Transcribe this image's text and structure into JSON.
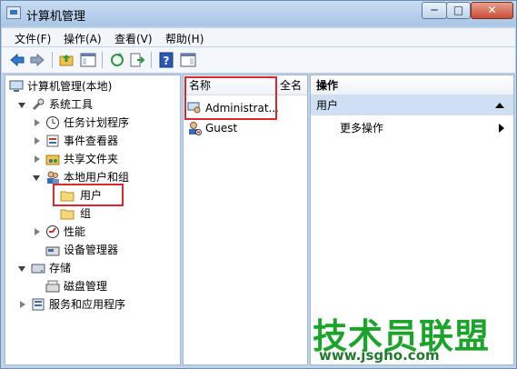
{
  "window": {
    "title": "计算机管理",
    "minimize": "─",
    "maximize": "□",
    "close": "✕"
  },
  "menu": [
    "文件(F)",
    "操作(A)",
    "查看(V)",
    "帮助(H)"
  ],
  "toolbar": {
    "icons": [
      "back-arrow-icon",
      "forward-arrow-icon",
      "folder-up-icon",
      "console-tree-icon",
      "refresh-icon",
      "export-list-icon",
      "help-icon",
      "show-hide-pane-icon"
    ]
  },
  "tree": [
    {
      "label": "计算机管理(本地)",
      "icon": "computer-management-icon",
      "level": 0,
      "expander": "none"
    },
    {
      "label": "系统工具",
      "icon": "tools-icon",
      "level": 1,
      "expander": "open"
    },
    {
      "label": "任务计划程序",
      "icon": "clock-icon",
      "level": 2,
      "expander": "closed"
    },
    {
      "label": "事件查看器",
      "icon": "event-viewer-icon",
      "level": 2,
      "expander": "closed"
    },
    {
      "label": "共享文件夹",
      "icon": "shared-folder-icon",
      "level": 2,
      "expander": "closed"
    },
    {
      "label": "本地用户和组",
      "icon": "users-group-icon",
      "level": 2,
      "expander": "open"
    },
    {
      "label": "用户",
      "icon": "folder-icon",
      "level": 3,
      "expander": "none",
      "selected": true
    },
    {
      "label": "组",
      "icon": "folder-icon",
      "level": 3,
      "expander": "none"
    },
    {
      "label": "性能",
      "icon": "performance-icon",
      "level": 2,
      "expander": "closed"
    },
    {
      "label": "设备管理器",
      "icon": "device-manager-icon",
      "level": 2,
      "expander": "none"
    },
    {
      "label": "存储",
      "icon": "storage-icon",
      "level": 1,
      "expander": "open"
    },
    {
      "label": "磁盘管理",
      "icon": "disk-management-icon",
      "level": 2,
      "expander": "none"
    },
    {
      "label": "服务和应用程序",
      "icon": "services-icon",
      "level": 1,
      "expander": "closed"
    }
  ],
  "list": {
    "columns": [
      "名称",
      "全名"
    ],
    "rows": [
      {
        "name": "Administrat...",
        "icon": "user-icon"
      },
      {
        "name": "Guest",
        "icon": "guest-user-icon"
      }
    ]
  },
  "actions": {
    "header": "操作",
    "section": "用户",
    "items": [
      "更多操作"
    ]
  },
  "watermark": {
    "text": "技术员联盟",
    "url": "www.jsgho.com"
  },
  "colors": {
    "highlight_red": "#e0252e",
    "window_blue": "#bcd3ea",
    "section_blue": "#cfe0f4"
  }
}
